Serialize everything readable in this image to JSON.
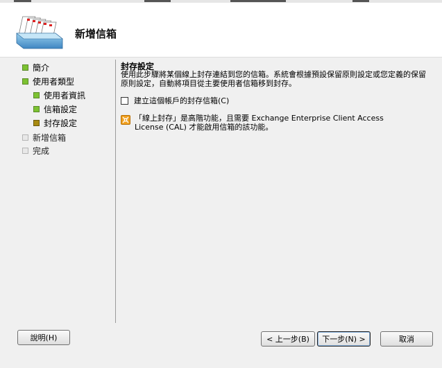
{
  "header": {
    "title": "新增信箱",
    "icon": "mailbox-icon"
  },
  "nav": {
    "items": [
      {
        "label": "簡介",
        "state": "done"
      },
      {
        "label": "使用者類型",
        "state": "done"
      },
      {
        "label": "使用者資訊",
        "state": "done"
      },
      {
        "label": "信箱設定",
        "state": "done"
      },
      {
        "label": "封存設定",
        "state": "current"
      },
      {
        "label": "新增信箱",
        "state": "pending"
      },
      {
        "label": "完成",
        "state": "pending"
      }
    ]
  },
  "main": {
    "title": "封存設定",
    "description": "使用此步驟將某個線上封存連結到您的信箱。系統會根據預設保留原則設定或您定義的保留原則設定，自動將項目從主要使用者信箱移到封存。",
    "checkbox_label": "建立這個帳戶的封存信箱(C)",
    "checkbox_checked": false,
    "info_text": "「線上封存」是高階功能，且需要 Exchange Enterprise Client Access License (CAL) 才能啟用信箱的該功能。"
  },
  "buttons": {
    "help": "說明(H)",
    "back": "< 上一步(B)",
    "next": "下一步(N) >",
    "cancel": "取消"
  },
  "colors": {
    "done_bullet": "#7cc232",
    "current_bullet": "#a88a10",
    "pending_bullet": "#e8e8e8",
    "warning": "#f0a020"
  }
}
